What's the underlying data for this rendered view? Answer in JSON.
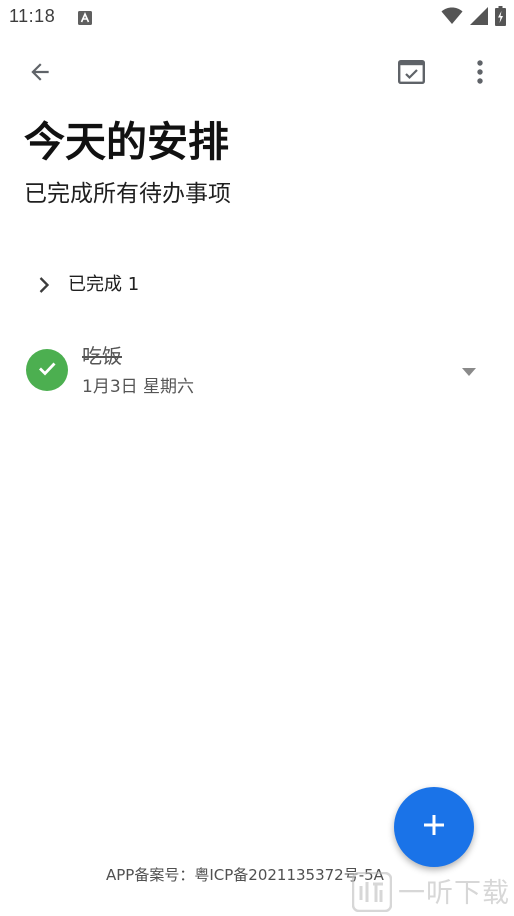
{
  "status_bar": {
    "time": "11:18",
    "notification_icon": "a-icon",
    "icons": [
      "wifi-icon",
      "signal-icon",
      "battery-charging-icon"
    ]
  },
  "toolbar": {
    "back_icon": "arrow-back-icon",
    "done_icon": "calendar-check-icon",
    "more_icon": "more-vertical-icon"
  },
  "page": {
    "title": "今天的安排",
    "subtitle": "已完成所有待办事项"
  },
  "completed_section": {
    "label": "已完成 1",
    "chevron_icon": "chevron-right-icon"
  },
  "tasks": [
    {
      "title": "吃饭",
      "date": "1月3日 星期六",
      "completed": true,
      "check_icon": "check-icon",
      "expand_icon": "dropdown-triangle-icon"
    }
  ],
  "fab": {
    "icon": "plus-icon"
  },
  "footer": {
    "text": "APP备案号：粤ICP备2021135372号-5A"
  },
  "watermark": {
    "text": "一听下载"
  },
  "colors": {
    "accent": "#1a73e8",
    "check_green": "#4caf50",
    "icon_gray": "#5f6368"
  }
}
